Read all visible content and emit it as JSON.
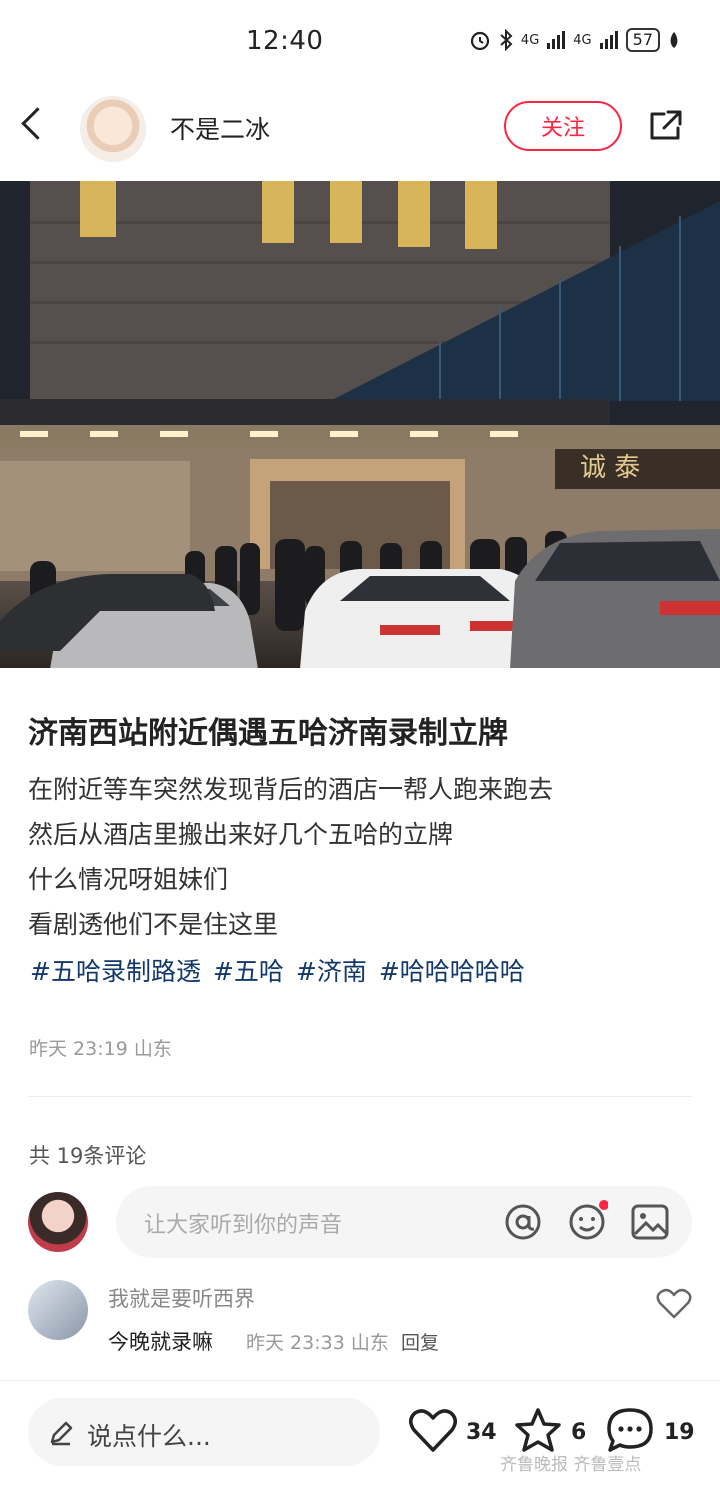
{
  "status_bar": {
    "time": "12:40",
    "network_1": "4G",
    "network_2": "4G",
    "battery": "57",
    "icons": [
      "alarm-icon",
      "bluetooth-icon",
      "signal-icon",
      "battery-icon",
      "leaf-icon"
    ]
  },
  "header": {
    "username": "不是二冰",
    "follow_label": "关注",
    "icons": [
      "back-icon",
      "share-icon"
    ]
  },
  "post": {
    "photo_sign": "诚 泰",
    "title": "济南西站附近偶遇五哈济南录制立牌",
    "lines": [
      "在附近等车突然发现背后的酒店一帮人跑来跑去",
      "然后从酒店里搬出来好几个五哈的立牌",
      "什么情况呀姐妹们",
      "看剧透他们不是住这里"
    ],
    "tags": [
      "#五哈录制路透",
      "#五哈",
      "#济南",
      "#哈哈哈哈哈"
    ],
    "time": "昨天 23:19",
    "location": "山东"
  },
  "comments": {
    "count_label": "共 19条评论",
    "input_placeholder": "让大家听到你的声音",
    "items": [
      {
        "author": "我就是要听西界",
        "text": "今晚就录嘛",
        "time": "昨天 23:33",
        "location": "山东",
        "reply_label": "回复"
      }
    ]
  },
  "bottom_bar": {
    "say_placeholder": "说点什么...",
    "likes": "34",
    "collects": "6",
    "comments": "19"
  },
  "watermark": "齐鲁晚报 齐鲁壹点",
  "colors": {
    "accent": "#ff2442",
    "tag": "#13386c"
  }
}
